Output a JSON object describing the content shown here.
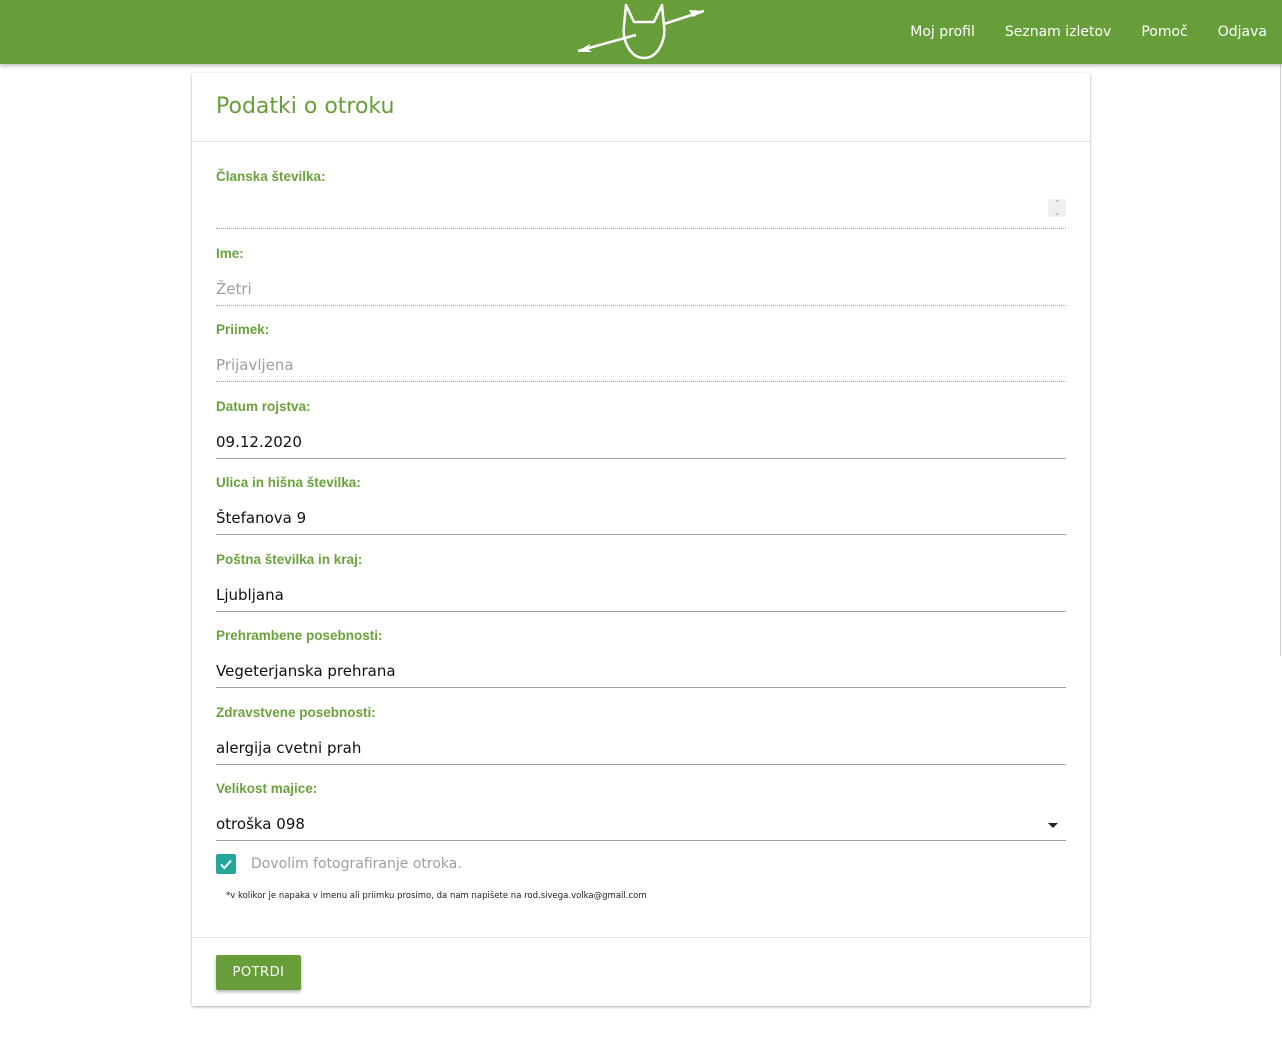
{
  "nav": {
    "links": [
      "Moj profil",
      "Seznam izletov",
      "Pomoč",
      "Odjava"
    ],
    "logo_icon": "wolf-arrow-logo"
  },
  "card": {
    "title": "Podatki o otroku"
  },
  "form": {
    "member_number": {
      "label": "Članska številka:",
      "value": ""
    },
    "first_name": {
      "label": "Ime:",
      "value": "Žetri"
    },
    "last_name": {
      "label": "Priimek:",
      "value": "Prijavljena"
    },
    "birth_date": {
      "label": "Datum rojstva:",
      "value": "09.12.2020"
    },
    "street": {
      "label": "Ulica in hišna številka:",
      "value": "Štefanova 9"
    },
    "postal": {
      "label": "Poštna številka in kraj:",
      "value": "Ljubljana"
    },
    "dietary": {
      "label": "Prehrambene posebnosti:",
      "value": "Vegeterjanska prehrana"
    },
    "health": {
      "label": "Zdravstvene posebnosti:",
      "value": "alergija cvetni prah"
    },
    "shirt_size": {
      "label": "Velikost majice:",
      "value": "otroška 098"
    },
    "photo_consent": {
      "label": "Dovolim fotografiranje otroka.",
      "checked": true
    },
    "note": "*v kolikor je napaka v imenu ali priimku prosimo, da nam napišete na rod.sivega.volka@gmail.com",
    "submit_label": "POTRDI"
  },
  "colors": {
    "brand_green": "#679e3a",
    "checkbox_teal": "#26a69a"
  }
}
